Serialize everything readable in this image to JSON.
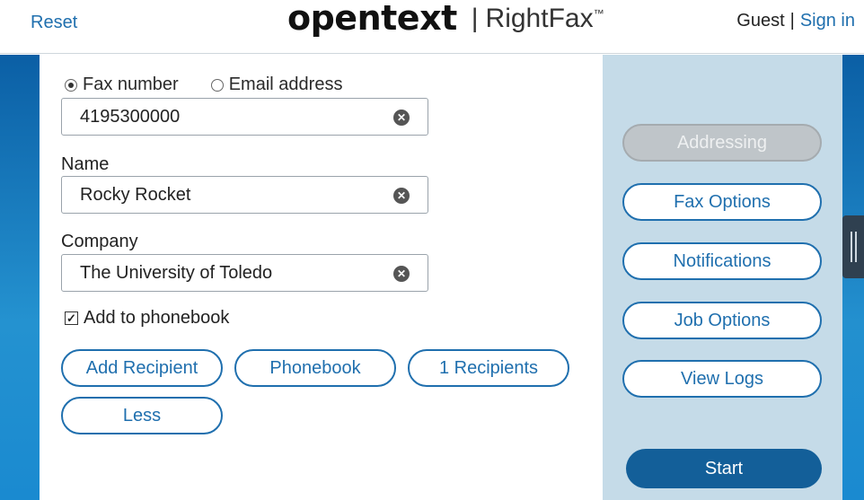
{
  "header": {
    "reset_label": "Reset",
    "brand_logo": "opentext",
    "brand_separator": "|",
    "brand_product": "RightFax",
    "brand_tm": "™",
    "user_label": "Guest",
    "user_separator": "|",
    "sign_in_label": "Sign in"
  },
  "addressing": {
    "mode_options": [
      {
        "label": "Fax number",
        "selected": true
      },
      {
        "label": "Email address",
        "selected": false
      }
    ],
    "fax_number_value": "4195300000",
    "name_label": "Name",
    "name_value": "Rocky Rocket",
    "company_label": "Company",
    "company_value": "The University of Toledo",
    "clear_icon": "close-circle-icon",
    "add_to_phonebook_label": "Add to phonebook",
    "add_to_phonebook_checked": true,
    "checkbox_mark": "✓"
  },
  "actions": {
    "add_recipient": "Add Recipient",
    "phonebook": "Phonebook",
    "recipients": "1 Recipients",
    "less": "Less"
  },
  "side_nav": {
    "addressing": "Addressing",
    "fax_options": "Fax Options",
    "notifications": "Notifications",
    "job_options": "Job Options",
    "view_logs": "View Logs",
    "start": "Start"
  },
  "colors": {
    "accent": "#1f6fae",
    "side_panel": "#c5dbe8",
    "start_button": "#135f99",
    "band": "#0b5fa5"
  }
}
